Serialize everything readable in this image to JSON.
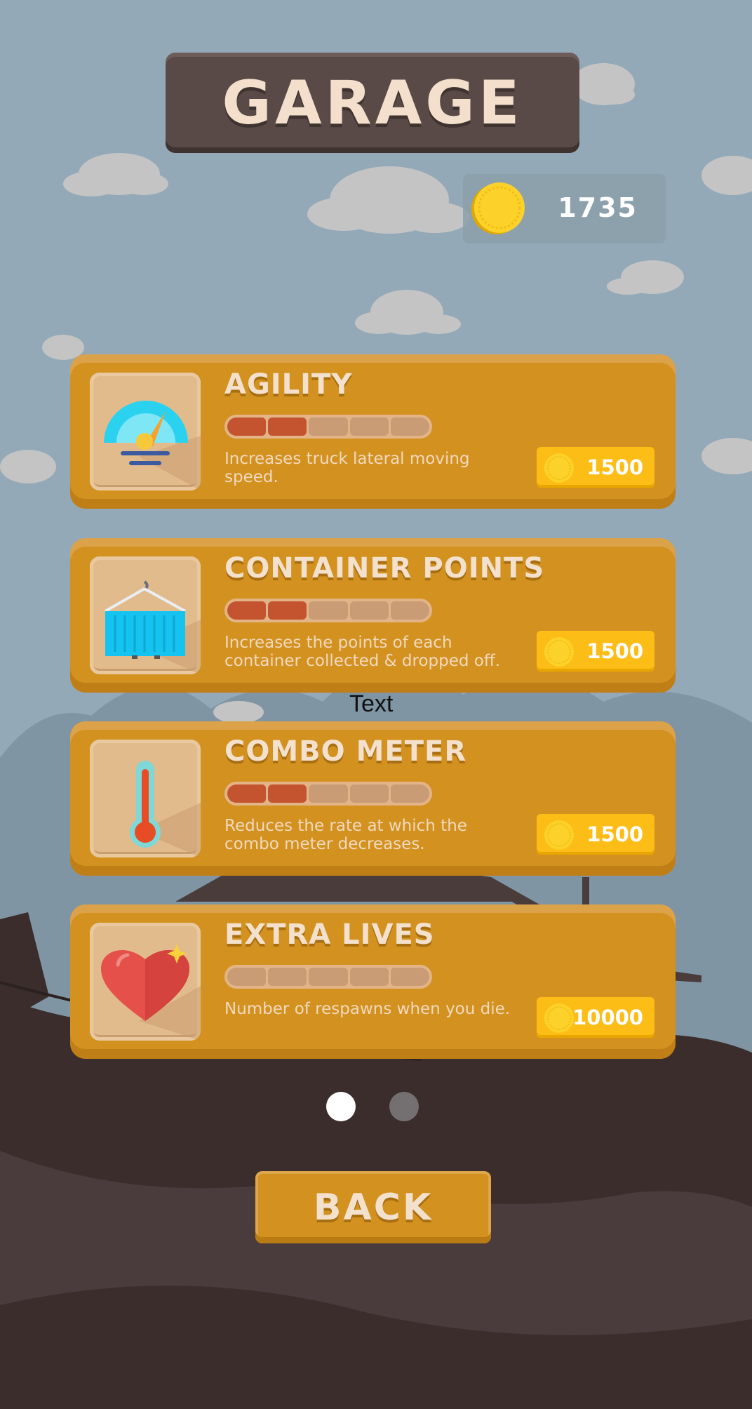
{
  "screen": {
    "title": "GARAGE",
    "coins": "1735",
    "stray_text": "Text",
    "back_label": "BACK"
  },
  "upgrades": [
    {
      "title": "AGILITY",
      "description": "Increases truck lateral moving speed.",
      "price": "1500",
      "level": 2,
      "max_level": 5,
      "icon": "speedometer-icon"
    },
    {
      "title": "CONTAINER POINTS",
      "description": "Increases the points of each container collected & dropped off.",
      "price": "1500",
      "level": 2,
      "max_level": 5,
      "icon": "container-icon"
    },
    {
      "title": "COMBO METER",
      "description": "Reduces the rate at which the combo meter decreases.",
      "price": "1500",
      "level": 2,
      "max_level": 5,
      "icon": "thermometer-icon"
    },
    {
      "title": "EXTRA LIVES",
      "description": "Number of respawns when you die.",
      "price": "10000",
      "level": 0,
      "max_level": 5,
      "icon": "heart-icon"
    }
  ],
  "pager": {
    "pages": 2,
    "active": 0
  },
  "colors": {
    "sky": "#93a9b7",
    "card": "#d3921f",
    "price_button": "#fdbd17",
    "level_on": "#c4532f",
    "title_board": "#5a4a47"
  }
}
